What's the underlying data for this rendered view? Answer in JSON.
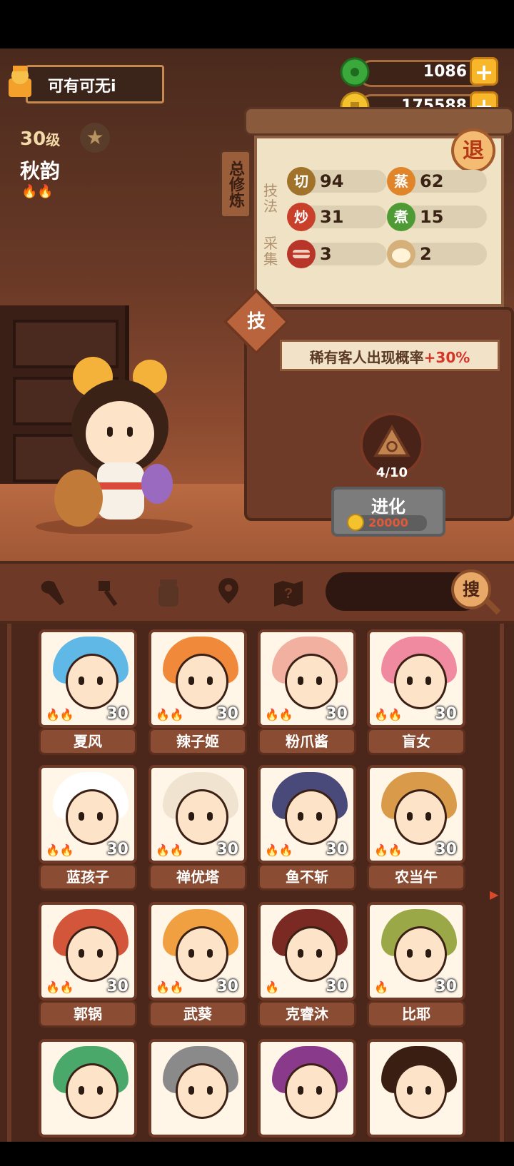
{
  "player": {
    "name": "可有可无i"
  },
  "resources": {
    "jade": "1086",
    "coins": "175588",
    "plus": "+"
  },
  "character": {
    "level": "30",
    "level_unit": "级",
    "name": "秋韵",
    "flames": "🔥🔥"
  },
  "panel": {
    "tab_label": "总修炼",
    "exit_label": "退",
    "technique_label": "技法",
    "gather_label": "采集",
    "stats": [
      {
        "icon": "切",
        "value": "94",
        "color": "#a0722a"
      },
      {
        "icon": "蒸",
        "value": "62",
        "color": "#e0852a"
      },
      {
        "icon": "炒",
        "value": "31",
        "color": "#c8402a"
      },
      {
        "icon": "煮",
        "value": "15",
        "color": "#4e9a34"
      },
      {
        "icon": "meat",
        "value": "3",
        "color": "#b8352a"
      },
      {
        "icon": "bun",
        "value": "2",
        "color": "#d6b07a"
      }
    ],
    "skill_button": "技",
    "banner_text": "稀有客人出现概率",
    "banner_bonus": "+30%",
    "evolve_progress": "4/10",
    "evolve_label": "进化",
    "evolve_cost": "20000"
  },
  "filters": {
    "icons": [
      "meat-leg-icon",
      "spatula-icon",
      "jar-icon",
      "map-pin-icon",
      "mystery-map-icon"
    ],
    "search_label": "搜"
  },
  "characters": [
    {
      "name": "夏风",
      "level": "30",
      "hair": "#5fb8e6",
      "flames": "🔥🔥"
    },
    {
      "name": "辣子姬",
      "level": "30",
      "hair": "#f08a3a",
      "flames": "🔥🔥"
    },
    {
      "name": "粉爪酱",
      "level": "30",
      "hair": "#f2b0a0",
      "flames": "🔥🔥"
    },
    {
      "name": "盲女",
      "level": "30",
      "hair": "#f08aa0",
      "flames": "🔥🔥"
    },
    {
      "name": "蓝孩子",
      "level": "30",
      "hair": "#ffffff",
      "flames": "🔥🔥"
    },
    {
      "name": "禅优塔",
      "level": "30",
      "hair": "#f0e4d0",
      "flames": "🔥🔥"
    },
    {
      "name": "鱼不斩",
      "level": "30",
      "hair": "#4a4a7a",
      "flames": "🔥🔥"
    },
    {
      "name": "农当午",
      "level": "30",
      "hair": "#d99a4a",
      "flames": "🔥🔥"
    },
    {
      "name": "郭锅",
      "level": "30",
      "hair": "#d4563a",
      "flames": "🔥🔥"
    },
    {
      "name": "武葵",
      "level": "30",
      "hair": "#f0a040",
      "flames": "🔥🔥"
    },
    {
      "name": "克睿沐",
      "level": "30",
      "hair": "#7a2a22",
      "flames": "🔥"
    },
    {
      "name": "比耶",
      "level": "30",
      "hair": "#9aa848",
      "flames": "🔥"
    },
    {
      "name": "",
      "level": "",
      "hair": "#4aa86a",
      "flames": ""
    },
    {
      "name": "",
      "level": "",
      "hair": "#8a8a8a",
      "flames": ""
    },
    {
      "name": "",
      "level": "",
      "hair": "#8a3a8a",
      "flames": ""
    },
    {
      "name": "",
      "level": "",
      "hair": "#3a1e12",
      "flames": ""
    }
  ]
}
